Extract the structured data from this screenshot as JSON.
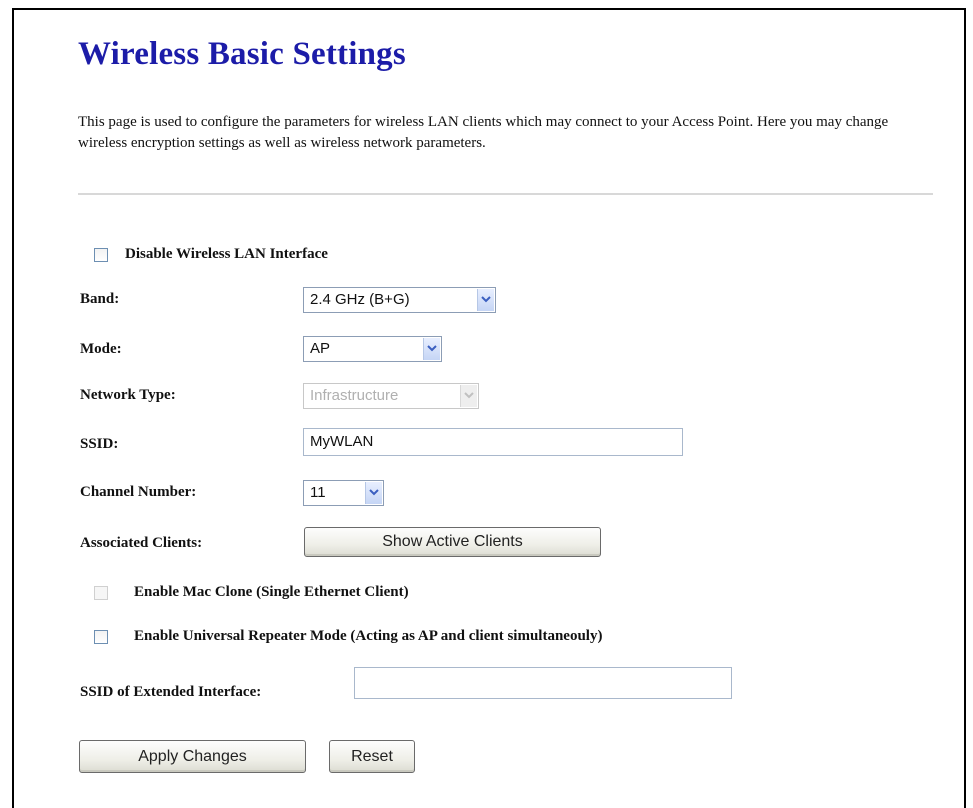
{
  "page": {
    "title": "Wireless Basic Settings",
    "description": "This page is used to configure the parameters for wireless LAN clients which may connect to your Access Point. Here you may change wireless encryption settings as well as wireless network parameters."
  },
  "form": {
    "disable_wlan": {
      "label": "Disable Wireless LAN Interface",
      "checked": false
    },
    "band": {
      "label": "Band:",
      "value": "2.4 GHz (B+G)"
    },
    "mode": {
      "label": "Mode:",
      "value": "AP"
    },
    "network_type": {
      "label": "Network Type:",
      "value": "Infrastructure",
      "disabled": true
    },
    "ssid": {
      "label": "SSID:",
      "value": "MyWLAN"
    },
    "channel": {
      "label": "Channel Number:",
      "value": "11"
    },
    "associated_clients": {
      "label": "Associated Clients:",
      "button": "Show Active Clients"
    },
    "mac_clone": {
      "label": "Enable Mac Clone (Single Ethernet Client)",
      "checked": false,
      "disabled": true
    },
    "universal_repeater": {
      "label": "Enable Universal Repeater Mode (Acting as AP and client simultaneouly)",
      "checked": false
    },
    "ssid_extended": {
      "label": "SSID of Extended Interface:",
      "value": ""
    }
  },
  "actions": {
    "apply": "Apply Changes",
    "reset": "Reset"
  },
  "icons": {
    "dropdown": "chevron-down-icon"
  },
  "colors": {
    "title": "#1c1ca8",
    "divider": "#d8d8d8",
    "dropdown_arrow": "#3b5fc0"
  }
}
